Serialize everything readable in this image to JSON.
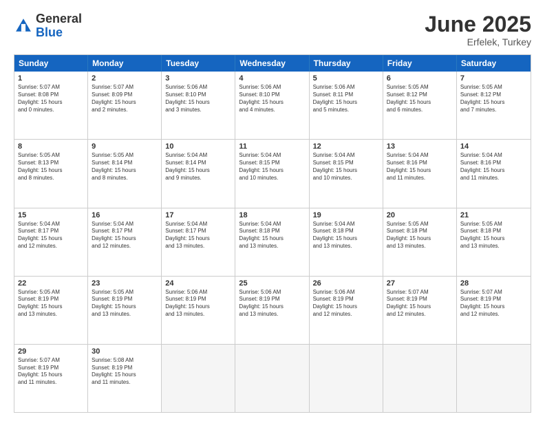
{
  "header": {
    "logo_general": "General",
    "logo_blue": "Blue",
    "month_title": "June 2025",
    "location": "Erfelek, Turkey"
  },
  "weekdays": [
    "Sunday",
    "Monday",
    "Tuesday",
    "Wednesday",
    "Thursday",
    "Friday",
    "Saturday"
  ],
  "rows": [
    [
      {
        "day": "1",
        "lines": [
          "Sunrise: 5:07 AM",
          "Sunset: 8:08 PM",
          "Daylight: 15 hours",
          "and 0 minutes."
        ]
      },
      {
        "day": "2",
        "lines": [
          "Sunrise: 5:07 AM",
          "Sunset: 8:09 PM",
          "Daylight: 15 hours",
          "and 2 minutes."
        ]
      },
      {
        "day": "3",
        "lines": [
          "Sunrise: 5:06 AM",
          "Sunset: 8:10 PM",
          "Daylight: 15 hours",
          "and 3 minutes."
        ]
      },
      {
        "day": "4",
        "lines": [
          "Sunrise: 5:06 AM",
          "Sunset: 8:10 PM",
          "Daylight: 15 hours",
          "and 4 minutes."
        ]
      },
      {
        "day": "5",
        "lines": [
          "Sunrise: 5:06 AM",
          "Sunset: 8:11 PM",
          "Daylight: 15 hours",
          "and 5 minutes."
        ]
      },
      {
        "day": "6",
        "lines": [
          "Sunrise: 5:05 AM",
          "Sunset: 8:12 PM",
          "Daylight: 15 hours",
          "and 6 minutes."
        ]
      },
      {
        "day": "7",
        "lines": [
          "Sunrise: 5:05 AM",
          "Sunset: 8:12 PM",
          "Daylight: 15 hours",
          "and 7 minutes."
        ]
      }
    ],
    [
      {
        "day": "8",
        "lines": [
          "Sunrise: 5:05 AM",
          "Sunset: 8:13 PM",
          "Daylight: 15 hours",
          "and 8 minutes."
        ]
      },
      {
        "day": "9",
        "lines": [
          "Sunrise: 5:05 AM",
          "Sunset: 8:14 PM",
          "Daylight: 15 hours",
          "and 8 minutes."
        ]
      },
      {
        "day": "10",
        "lines": [
          "Sunrise: 5:04 AM",
          "Sunset: 8:14 PM",
          "Daylight: 15 hours",
          "and 9 minutes."
        ]
      },
      {
        "day": "11",
        "lines": [
          "Sunrise: 5:04 AM",
          "Sunset: 8:15 PM",
          "Daylight: 15 hours",
          "and 10 minutes."
        ]
      },
      {
        "day": "12",
        "lines": [
          "Sunrise: 5:04 AM",
          "Sunset: 8:15 PM",
          "Daylight: 15 hours",
          "and 10 minutes."
        ]
      },
      {
        "day": "13",
        "lines": [
          "Sunrise: 5:04 AM",
          "Sunset: 8:16 PM",
          "Daylight: 15 hours",
          "and 11 minutes."
        ]
      },
      {
        "day": "14",
        "lines": [
          "Sunrise: 5:04 AM",
          "Sunset: 8:16 PM",
          "Daylight: 15 hours",
          "and 11 minutes."
        ]
      }
    ],
    [
      {
        "day": "15",
        "lines": [
          "Sunrise: 5:04 AM",
          "Sunset: 8:17 PM",
          "Daylight: 15 hours",
          "and 12 minutes."
        ]
      },
      {
        "day": "16",
        "lines": [
          "Sunrise: 5:04 AM",
          "Sunset: 8:17 PM",
          "Daylight: 15 hours",
          "and 12 minutes."
        ]
      },
      {
        "day": "17",
        "lines": [
          "Sunrise: 5:04 AM",
          "Sunset: 8:17 PM",
          "Daylight: 15 hours",
          "and 13 minutes."
        ]
      },
      {
        "day": "18",
        "lines": [
          "Sunrise: 5:04 AM",
          "Sunset: 8:18 PM",
          "Daylight: 15 hours",
          "and 13 minutes."
        ]
      },
      {
        "day": "19",
        "lines": [
          "Sunrise: 5:04 AM",
          "Sunset: 8:18 PM",
          "Daylight: 15 hours",
          "and 13 minutes."
        ]
      },
      {
        "day": "20",
        "lines": [
          "Sunrise: 5:05 AM",
          "Sunset: 8:18 PM",
          "Daylight: 15 hours",
          "and 13 minutes."
        ]
      },
      {
        "day": "21",
        "lines": [
          "Sunrise: 5:05 AM",
          "Sunset: 8:18 PM",
          "Daylight: 15 hours",
          "and 13 minutes."
        ]
      }
    ],
    [
      {
        "day": "22",
        "lines": [
          "Sunrise: 5:05 AM",
          "Sunset: 8:19 PM",
          "Daylight: 15 hours",
          "and 13 minutes."
        ]
      },
      {
        "day": "23",
        "lines": [
          "Sunrise: 5:05 AM",
          "Sunset: 8:19 PM",
          "Daylight: 15 hours",
          "and 13 minutes."
        ]
      },
      {
        "day": "24",
        "lines": [
          "Sunrise: 5:06 AM",
          "Sunset: 8:19 PM",
          "Daylight: 15 hours",
          "and 13 minutes."
        ]
      },
      {
        "day": "25",
        "lines": [
          "Sunrise: 5:06 AM",
          "Sunset: 8:19 PM",
          "Daylight: 15 hours",
          "and 13 minutes."
        ]
      },
      {
        "day": "26",
        "lines": [
          "Sunrise: 5:06 AM",
          "Sunset: 8:19 PM",
          "Daylight: 15 hours",
          "and 12 minutes."
        ]
      },
      {
        "day": "27",
        "lines": [
          "Sunrise: 5:07 AM",
          "Sunset: 8:19 PM",
          "Daylight: 15 hours",
          "and 12 minutes."
        ]
      },
      {
        "day": "28",
        "lines": [
          "Sunrise: 5:07 AM",
          "Sunset: 8:19 PM",
          "Daylight: 15 hours",
          "and 12 minutes."
        ]
      }
    ],
    [
      {
        "day": "29",
        "lines": [
          "Sunrise: 5:07 AM",
          "Sunset: 8:19 PM",
          "Daylight: 15 hours",
          "and 11 minutes."
        ]
      },
      {
        "day": "30",
        "lines": [
          "Sunrise: 5:08 AM",
          "Sunset: 8:19 PM",
          "Daylight: 15 hours",
          "and 11 minutes."
        ]
      },
      {
        "day": "",
        "lines": []
      },
      {
        "day": "",
        "lines": []
      },
      {
        "day": "",
        "lines": []
      },
      {
        "day": "",
        "lines": []
      },
      {
        "day": "",
        "lines": []
      }
    ]
  ]
}
